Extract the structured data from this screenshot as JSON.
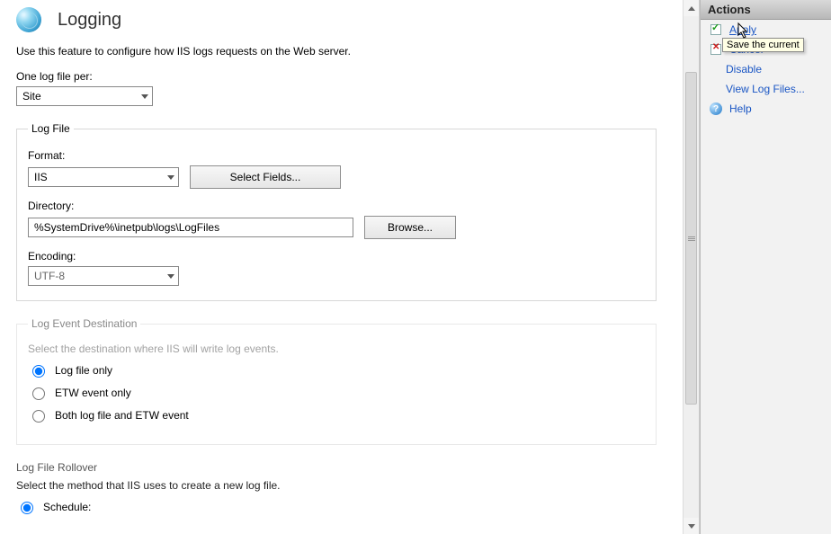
{
  "header": {
    "title": "Logging",
    "description": "Use this feature to configure how IIS logs requests on the Web server."
  },
  "one_log_file_per": {
    "label": "One log file per:",
    "value": "Site"
  },
  "log_file_group": {
    "legend": "Log File",
    "format_label": "Format:",
    "format_value": "IIS",
    "select_fields_btn": "Select Fields...",
    "directory_label": "Directory:",
    "directory_value": "%SystemDrive%\\inetpub\\logs\\LogFiles",
    "browse_btn": "Browse...",
    "encoding_label": "Encoding:",
    "encoding_value": "UTF-8"
  },
  "dest_group": {
    "legend": "Log Event Destination",
    "desc": "Select the destination where IIS will write log events.",
    "options": {
      "log_file_only": "Log file only",
      "etw_only": "ETW event only",
      "both": "Both log file and ETW event"
    },
    "selected": "log_file_only"
  },
  "rollover_group": {
    "legend": "Log File Rollover",
    "desc": "Select the method that IIS uses to create a new log file.",
    "schedule_label": "Schedule:"
  },
  "actions": {
    "header": "Actions",
    "apply": "Apply",
    "cancel": "Cancel",
    "disable": "Disable",
    "view_logs": "View Log Files...",
    "help": "Help",
    "tooltip": "Save the current"
  }
}
